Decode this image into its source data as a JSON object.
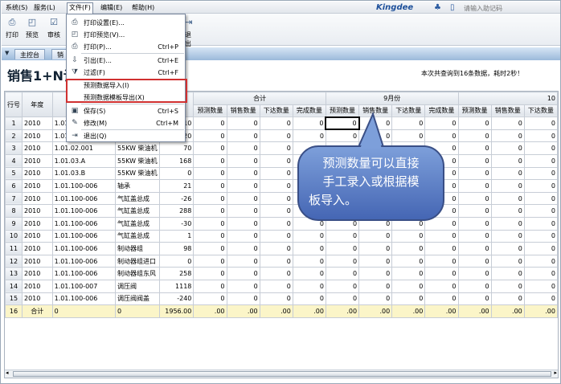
{
  "menubar": {
    "items": [
      "系统(S)",
      "服务(L)",
      "文件(F)",
      "编辑(E)",
      "帮助(H)"
    ],
    "brand": "Kingdee",
    "help_placeholder": "请输入助记码"
  },
  "toolbar": {
    "items": [
      "打印",
      "预览",
      "审核"
    ],
    "exit_fragment": "退出"
  },
  "tabs": [
    "主控台",
    "销"
  ],
  "title": "销售1+N计",
  "status_message": "本次共查询到16条数据，耗时2秒！",
  "dropdown": {
    "items": [
      {
        "icon": "printer-setup-icon",
        "label": "打印设置(E)...",
        "shortcut": ""
      },
      {
        "icon": "print-preview-icon",
        "label": "打印预览(V)...",
        "shortcut": ""
      },
      {
        "icon": "printer-icon",
        "label": "打印(P)...",
        "shortcut": "Ctrl+P"
      },
      {
        "icon": "import-icon",
        "label": "引出(E)...",
        "shortcut": "Ctrl+E"
      },
      {
        "icon": "filter-icon",
        "label": "过滤(F)",
        "shortcut": "Ctrl+F"
      },
      {
        "icon": "",
        "label": "预测数据导入(I)",
        "shortcut": ""
      },
      {
        "icon": "",
        "label": "预测数据模板导出(X)",
        "shortcut": ""
      },
      {
        "icon": "save-icon",
        "label": "保存(S)",
        "shortcut": "Ctrl+S"
      },
      {
        "icon": "edit-icon",
        "label": "修改(M)",
        "shortcut": "Ctrl+M"
      },
      {
        "icon": "exit-icon",
        "label": "退出(Q)",
        "shortcut": ""
      }
    ]
  },
  "grid": {
    "fixed_headers": [
      "行号",
      "年度",
      "产"
    ],
    "group_headers": [
      "合计",
      "9月份",
      "10"
    ],
    "sub_headers": [
      "预测数量",
      "销售数量",
      "下达数量",
      "完成数量"
    ],
    "rows": [
      {
        "no": "1",
        "year": "2010",
        "code": "1.01.",
        "name": "",
        "qty": "10"
      },
      {
        "no": "2",
        "year": "2010",
        "code": "1.01.",
        "name": "",
        "qty": "220"
      },
      {
        "no": "3",
        "year": "2010",
        "code": "1.01.02.001",
        "name": "55KW 柴油机",
        "qty": "70"
      },
      {
        "no": "4",
        "year": "2010",
        "code": "1.01.03.A",
        "name": "55KW 柴油机",
        "qty": "168"
      },
      {
        "no": "5",
        "year": "2010",
        "code": "1.01.03.B",
        "name": "55KW 柴油机",
        "qty": "0"
      },
      {
        "no": "6",
        "year": "2010",
        "code": "1.01.100-006",
        "name": "轴承",
        "qty": "21"
      },
      {
        "no": "7",
        "year": "2010",
        "code": "1.01.100-006",
        "name": "气缸盖总成",
        "qty": "-26"
      },
      {
        "no": "8",
        "year": "2010",
        "code": "1.01.100-006",
        "name": "气缸盖总成",
        "qty": "288"
      },
      {
        "no": "9",
        "year": "2010",
        "code": "1.01.100-006",
        "name": "气缸盖总成",
        "qty": "-30"
      },
      {
        "no": "10",
        "year": "2010",
        "code": "1.01.100-006",
        "name": "气缸盖总成",
        "qty": "1"
      },
      {
        "no": "11",
        "year": "2010",
        "code": "1.01.100-006",
        "name": "制动器组",
        "qty": "98"
      },
      {
        "no": "12",
        "year": "2010",
        "code": "1.01.100-006",
        "name": "制动器组进口",
        "qty": "0"
      },
      {
        "no": "13",
        "year": "2010",
        "code": "1.01.100-006",
        "name": "制动器组东风",
        "qty": "258"
      },
      {
        "no": "14",
        "year": "2010",
        "code": "1.01.100-007",
        "name": "调压阀",
        "qty": "1118"
      },
      {
        "no": "15",
        "year": "2010",
        "code": "1.01.100-006",
        "name": "调压阀阀盖",
        "qty": "-240"
      }
    ],
    "zero": "0",
    "total": {
      "no": "16",
      "label": "合计",
      "year": "0",
      "code": "0",
      "qty": "1956.00",
      "value": ".00"
    }
  },
  "callout": {
    "lines": [
      "预测数量可以直接",
      "手工录入或根据模",
      "板导入。"
    ]
  },
  "colors": {
    "highlight_border": "#d03030",
    "callout_fill": "#5b7dc5",
    "total_row": "#fbf5c8"
  }
}
